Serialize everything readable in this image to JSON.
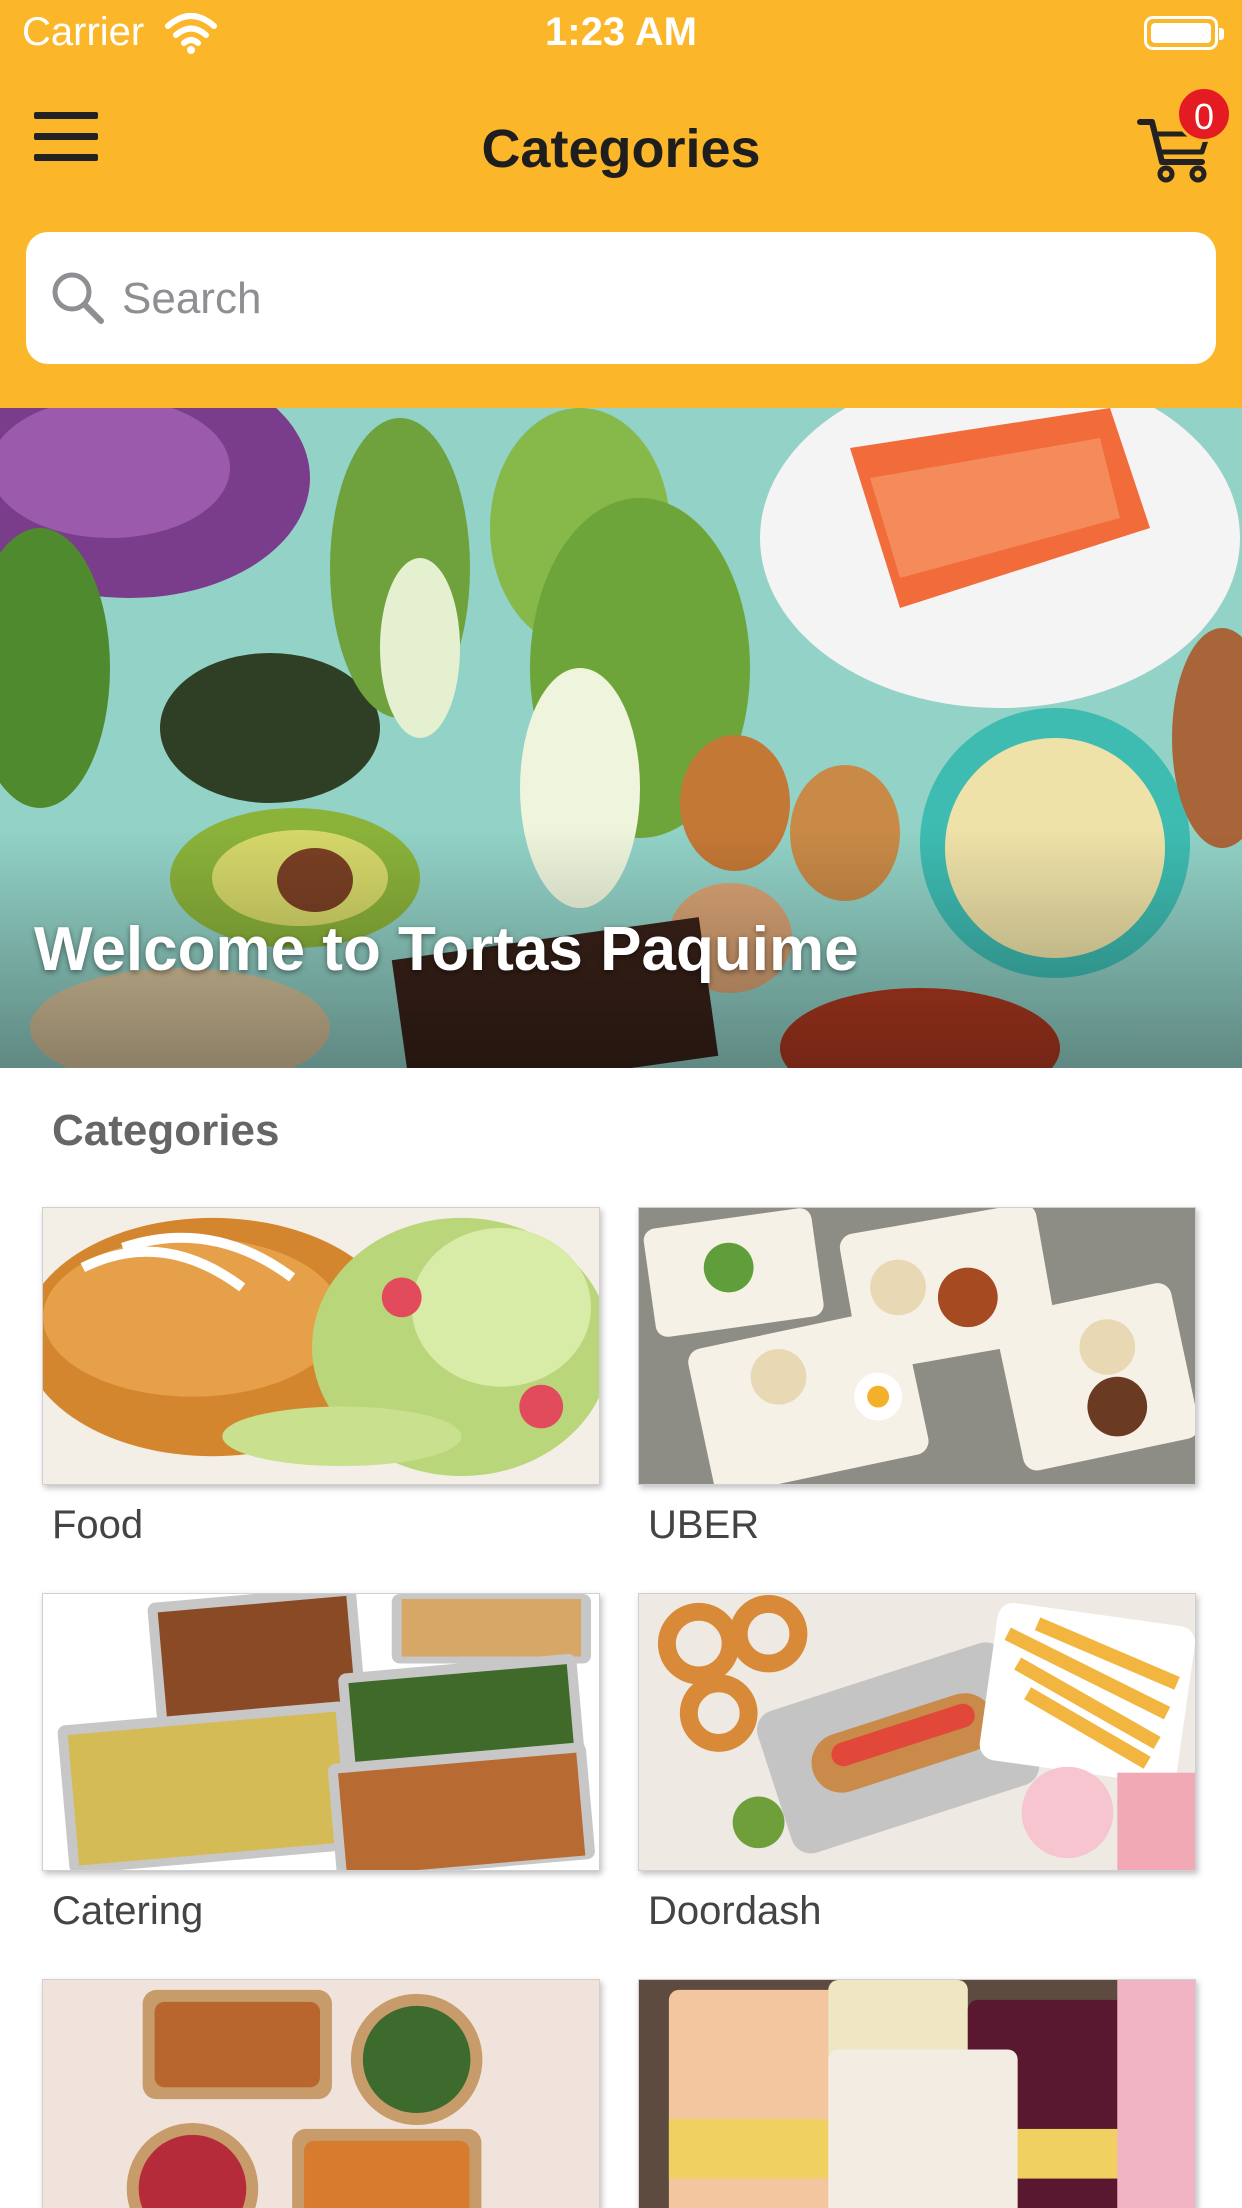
{
  "status_bar": {
    "carrier": "Carrier",
    "time": "1:23 AM"
  },
  "header": {
    "title": "Categories",
    "cart_count": "0"
  },
  "search": {
    "placeholder": "Search"
  },
  "hero": {
    "welcome_text": "Welcome to Tortas Paquime"
  },
  "section": {
    "title": "Categories"
  },
  "categories": [
    {
      "label": "Food"
    },
    {
      "label": "UBER"
    },
    {
      "label": "Catering"
    },
    {
      "label": "Doordash"
    },
    {
      "label": ""
    },
    {
      "label": ""
    }
  ],
  "colors": {
    "accent": "#FBB62A",
    "badge": "#E51B23",
    "title_text": "#1e1e1e"
  },
  "icons": [
    "menu-icon",
    "cart-icon",
    "search-icon",
    "wifi-icon",
    "battery-icon"
  ]
}
